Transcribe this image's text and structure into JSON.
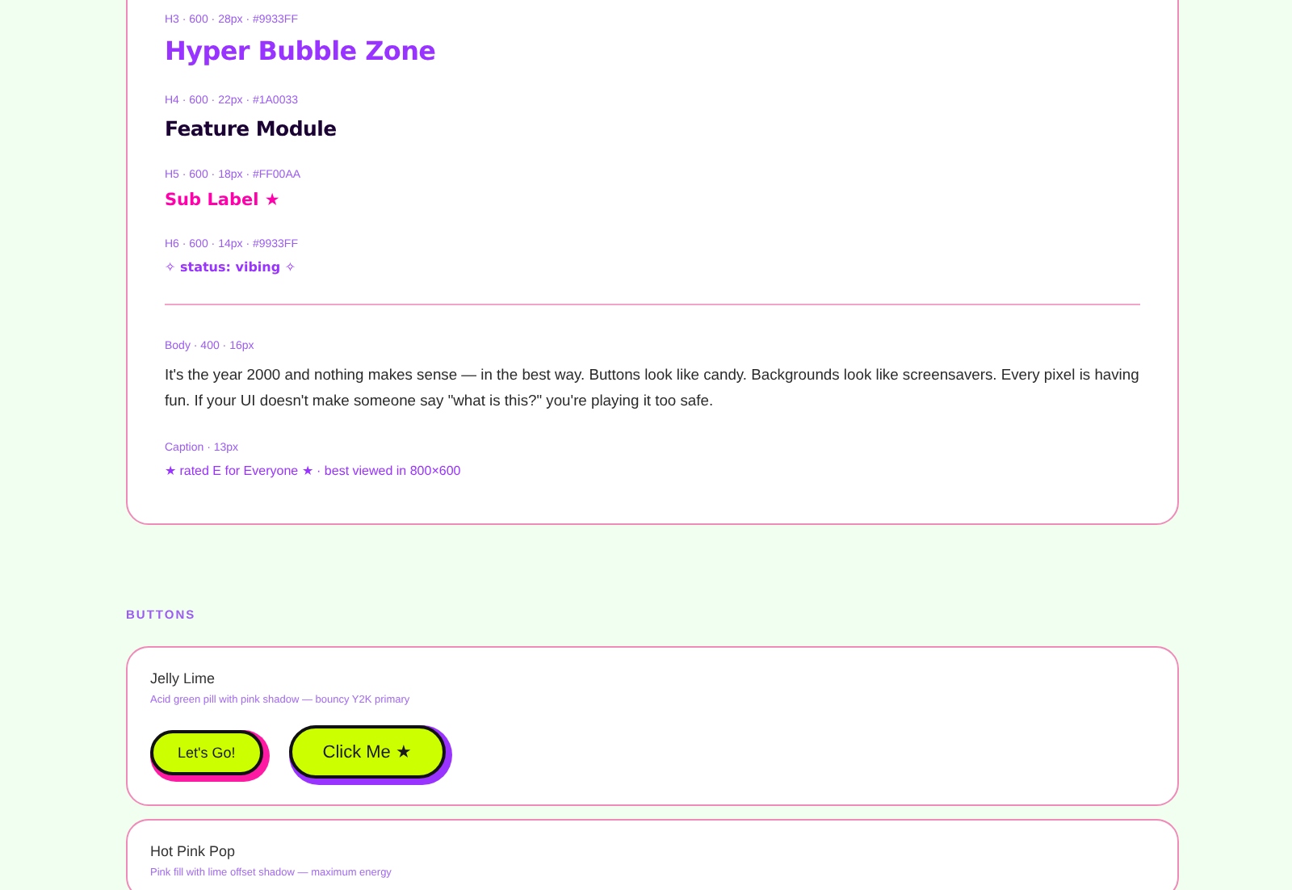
{
  "type_samples": [
    {
      "label": "H3 · 600 · 28px · #9933FF",
      "text": "Hyper Bubble Zone",
      "kind": "h3"
    },
    {
      "label": "H4 · 600 · 22px · #1A0033",
      "text": "Feature Module",
      "kind": "h4"
    },
    {
      "label": "H5 · 600 · 18px · #FF00AA",
      "text": "Sub Label ★",
      "kind": "h5"
    },
    {
      "label": "H6 · 600 · 14px · #9933FF",
      "text": "✧ status: vibing ✧",
      "kind": "h6"
    }
  ],
  "body": {
    "label": "Body · 400 · 16px",
    "text": "It's the year 2000 and nothing makes sense — in the best way. Buttons look like candy. Backgrounds look like screensavers. Every pixel is having fun. If your UI doesn't make someone say \"what is this?\" you're playing it too safe."
  },
  "caption": {
    "label": "Caption · 13px",
    "text": "★ rated E for Everyone ★ · best viewed in 800×600"
  },
  "section_title": "BUTTONS",
  "button_cards": [
    {
      "title": "Jelly Lime",
      "description": "Acid green pill with pink shadow — bouncy Y2K primary",
      "buttons": [
        {
          "label": "Let's Go!",
          "kind": "small",
          "color": "#ff1aa3"
        },
        {
          "label": "Click Me ★",
          "kind": "large",
          "color": "#9933ff"
        }
      ]
    },
    {
      "title": "Hot Pink Pop",
      "description": "Pink fill with lime offset shadow — maximum energy"
    }
  ]
}
